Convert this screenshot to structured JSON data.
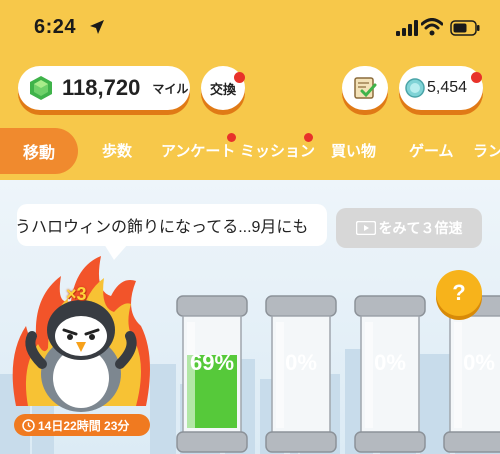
{
  "status": {
    "time": "6:24"
  },
  "header": {
    "miles_value": "118,720",
    "miles_unit": "マイル",
    "exchange_label": "交換",
    "coin_value": "5,454"
  },
  "tabs": [
    {
      "label": "移動",
      "active": true
    },
    {
      "label": "歩数"
    },
    {
      "label": "アンケート",
      "badge": true
    },
    {
      "label": "ミッション",
      "badge": true
    },
    {
      "label": "買い物"
    },
    {
      "label": "ゲーム"
    },
    {
      "label": "ラン"
    }
  ],
  "main": {
    "bubble_text": "うハロウィンの飾りになってる...9月にも",
    "triple_button": "をみて３倍速",
    "multiplier": "×3",
    "help_label": "?",
    "timer": "14日22時間 23分",
    "tanks": [
      {
        "label": "69%",
        "fill": 0.69
      },
      {
        "label": "0%",
        "fill": 0
      },
      {
        "label": "0%",
        "fill": 0
      },
      {
        "label": "0%",
        "fill": 0
      }
    ]
  },
  "colors": {
    "header_yellow": "#f7c84a",
    "accent_orange": "#f08a2e",
    "badge_red": "#e8322a",
    "tank_green": "#56c93a"
  }
}
